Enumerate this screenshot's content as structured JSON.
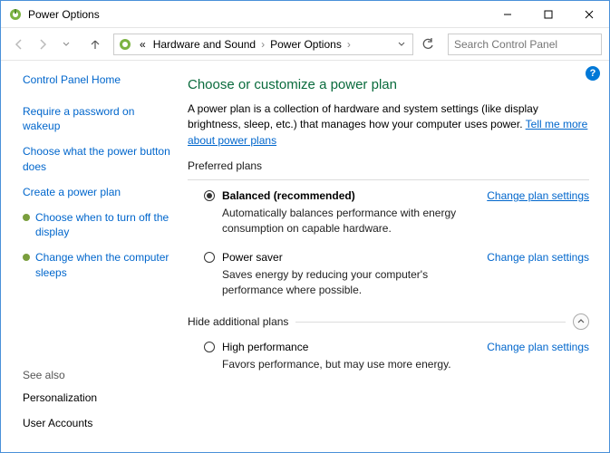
{
  "window": {
    "title": "Power Options"
  },
  "breadcrumb": {
    "prefix": "«",
    "seg1": "Hardware and Sound",
    "seg2": "Power Options"
  },
  "search": {
    "placeholder": "Search Control Panel"
  },
  "sidebar": {
    "home": "Control Panel Home",
    "links": {
      "0": "Require a password on wakeup",
      "1": "Choose what the power button does",
      "2": "Create a power plan",
      "3": "Choose when to turn off the display",
      "4": "Change when the computer sleeps"
    },
    "seealso": "See also",
    "bottom": {
      "0": "Personalization",
      "1": "User Accounts"
    }
  },
  "content": {
    "heading": "Choose or customize a power plan",
    "desc_pre": "A power plan is a collection of hardware and system settings (like display brightness, sleep, etc.) that manages how your computer uses power. ",
    "tell_more": "Tell me more about power plans",
    "preferred": "Preferred plans",
    "plans": {
      "balanced": {
        "name": "Balanced (recommended)",
        "desc": "Automatically balances performance with energy consumption on capable hardware.",
        "change": "Change plan settings"
      },
      "saver": {
        "name": "Power saver",
        "desc": "Saves energy by reducing your computer's performance where possible.",
        "change": "Change plan settings"
      },
      "high": {
        "name": "High performance",
        "desc": "Favors performance, but may use more energy.",
        "change": "Change plan settings"
      }
    },
    "hide_additional": "Hide additional plans"
  }
}
